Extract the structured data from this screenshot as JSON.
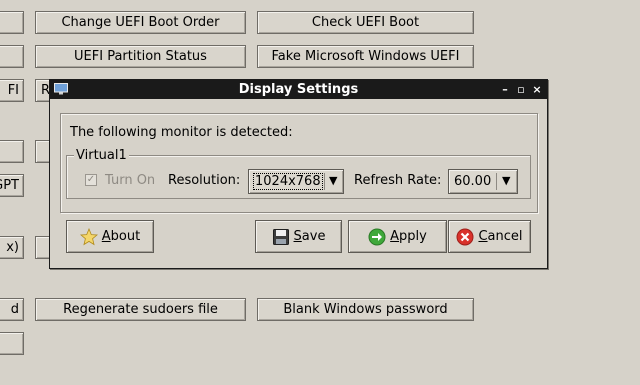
{
  "background": {
    "buttons": [
      {
        "label": "Change UEFI Boot Order"
      },
      {
        "label": "Check UEFI Boot"
      },
      {
        "label": "UEFI Partition Status"
      },
      {
        "label": "Fake Microsoft Windows UEFI"
      },
      {
        "label": "Regenerate sudoers file"
      },
      {
        "label": "Blank Windows password"
      }
    ],
    "left_fragments": [
      "FI",
      "GPT",
      "x)",
      "d"
    ],
    "partial_under_dialog": "R"
  },
  "dialog": {
    "title": "Display Settings",
    "detected_text": "The following monitor is detected:",
    "monitor_name": "Virtual1",
    "turn_on_label": "Turn On",
    "turn_on_checked": true,
    "turn_on_enabled": false,
    "resolution_label": "Resolution:",
    "resolution_value": "1024x768",
    "refresh_label": "Refresh Rate:",
    "refresh_value": "60.00",
    "buttons": {
      "about": {
        "mnemonic": "A",
        "rest": "bout"
      },
      "save": {
        "mnemonic": "S",
        "rest": "ave"
      },
      "apply": {
        "mnemonic": "A",
        "rest": "pply"
      },
      "cancel": {
        "mnemonic": "C",
        "rest": "ancel"
      }
    }
  }
}
